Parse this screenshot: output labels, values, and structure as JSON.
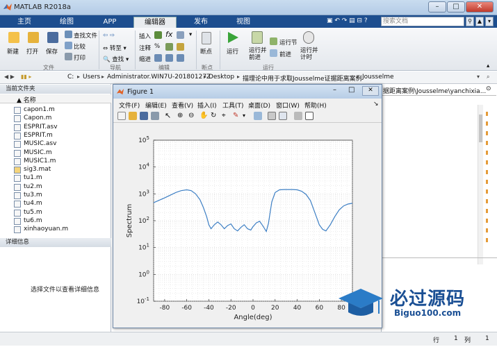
{
  "window": {
    "title": "MATLAB R2018a",
    "min": "–",
    "max": "□",
    "close": "✕"
  },
  "tabs": [
    "主页",
    "绘图",
    "APP",
    "编辑器",
    "发布",
    "视图"
  ],
  "search": {
    "placeholder": "搜索文档"
  },
  "ribbon": {
    "new": "新建",
    "open": "打开",
    "save": "保存",
    "find_files": "查找文件",
    "compare": "比较",
    "print": "打印",
    "go_to": "转至",
    "find": "查找",
    "insert": "插入",
    "comment": "注释",
    "indent": "缩进",
    "breakpoints": "断点",
    "run": "运行",
    "run_advance": "运行并\n前进",
    "run_section": "运行节",
    "advance": "前进",
    "run_time": "运行并\n计时",
    "groups": {
      "file": "文件",
      "navigate": "导航",
      "edit": "编辑",
      "breakpoints": "断点",
      "run": "运行"
    }
  },
  "address": {
    "crumbs": [
      "C:",
      "Users",
      "Administrator.WIN7U-20180127Z",
      "Desktop",
      "描理论中用于求取Jousselme证据距离案例",
      "Jousselme"
    ],
    "right_fragment": "据距离案例\\Jousselme\\yanchixia..."
  },
  "current_folder": {
    "title": "当前文件夹",
    "column": "名称",
    "files": [
      "capon1.m",
      "Capon.m",
      "ESPRIT.asv",
      "ESPRIT.m",
      "MUSIC.asv",
      "MUSIC.m",
      "MUSIC1.m",
      "sig3.mat",
      "tu1.m",
      "tu2.m",
      "tu3.m",
      "tu4.m",
      "tu5.m",
      "tu6.m",
      "xinhaoyuan.m"
    ]
  },
  "details": {
    "title": "详细信息",
    "hint": "选择文件以查看详细信息"
  },
  "status": {
    "row_label": "行",
    "row": "1",
    "col_label": "列",
    "col": "1"
  },
  "figure": {
    "title": "Figure 1",
    "menu": [
      "文件(F)",
      "编辑(E)",
      "查看(V)",
      "插入(I)",
      "工具(T)",
      "桌面(D)",
      "窗口(W)",
      "帮助(H)"
    ]
  },
  "watermark": {
    "brand": "必过源码",
    "url": "Biguo100.com"
  },
  "chart_data": {
    "type": "line",
    "xlabel": "Angle(deg)",
    "ylabel": "Spectrum",
    "xlim": [
      -90,
      90
    ],
    "y_log_exponent_lim": [
      -1,
      5
    ],
    "yscale": "log",
    "xticks": [
      -80,
      -60,
      -40,
      -20,
      0,
      20,
      40,
      60,
      80
    ],
    "yticks": [
      "10^-1",
      "10^0",
      "10^1",
      "10^2",
      "10^3",
      "10^4",
      "10^5"
    ],
    "grid": true,
    "color": "#3d7fc4",
    "x": [
      -90,
      -85,
      -80,
      -75,
      -70,
      -65,
      -60,
      -56,
      -52,
      -48,
      -45,
      -42,
      -40,
      -38,
      -35,
      -32,
      -29,
      -26,
      -23,
      -20,
      -17,
      -14,
      -11,
      -8,
      -5,
      -2,
      0,
      3,
      6,
      9,
      12,
      14,
      17,
      20,
      24,
      28,
      32,
      36,
      40,
      44,
      48,
      52,
      56,
      60,
      63,
      66,
      70,
      74,
      78,
      82,
      86,
      90
    ],
    "y_exp": [
      2.67,
      2.76,
      2.85,
      2.95,
      3.05,
      3.12,
      3.15,
      3.12,
      3.0,
      2.78,
      2.5,
      2.15,
      1.85,
      1.7,
      1.85,
      1.95,
      1.85,
      1.7,
      1.82,
      1.88,
      1.7,
      1.62,
      1.75,
      1.85,
      1.7,
      1.65,
      1.78,
      1.92,
      1.98,
      1.8,
      1.6,
      1.9,
      2.7,
      3.05,
      3.15,
      3.16,
      3.16,
      3.16,
      3.15,
      3.1,
      2.98,
      2.75,
      2.3,
      1.85,
      1.68,
      1.62,
      1.85,
      2.15,
      2.4,
      2.55,
      2.62,
      2.65
    ]
  }
}
